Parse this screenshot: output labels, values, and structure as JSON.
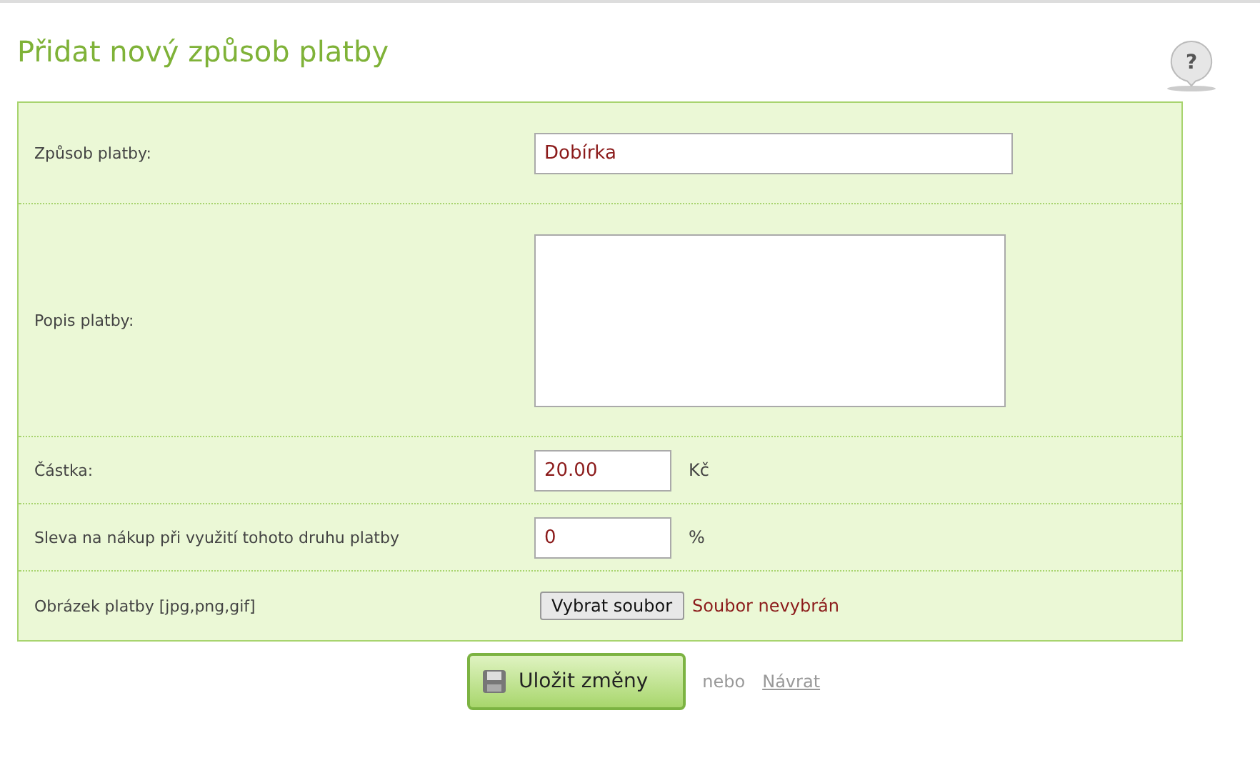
{
  "title": "Přidat nový způsob platby",
  "help_icon": "?",
  "rows": [
    {
      "kind": "text",
      "label": "Způsob platby:",
      "value": "Dobírka"
    },
    {
      "kind": "textarea",
      "label": "Popis platby:"
    },
    {
      "kind": "amount",
      "label": "Částka:",
      "value": "20.00",
      "unit": "Kč"
    },
    {
      "kind": "amount",
      "label": "Sleva na nákup při využití tohoto druhu platby",
      "value": "0",
      "unit": "%"
    },
    {
      "kind": "file",
      "label": "Obrázek platby [jpg,png,gif]",
      "button": "Vybrat soubor",
      "status": "Soubor nevybrán"
    }
  ],
  "save_button": "Uložit změny",
  "or_text": "nebo",
  "back_link": "Návrat"
}
